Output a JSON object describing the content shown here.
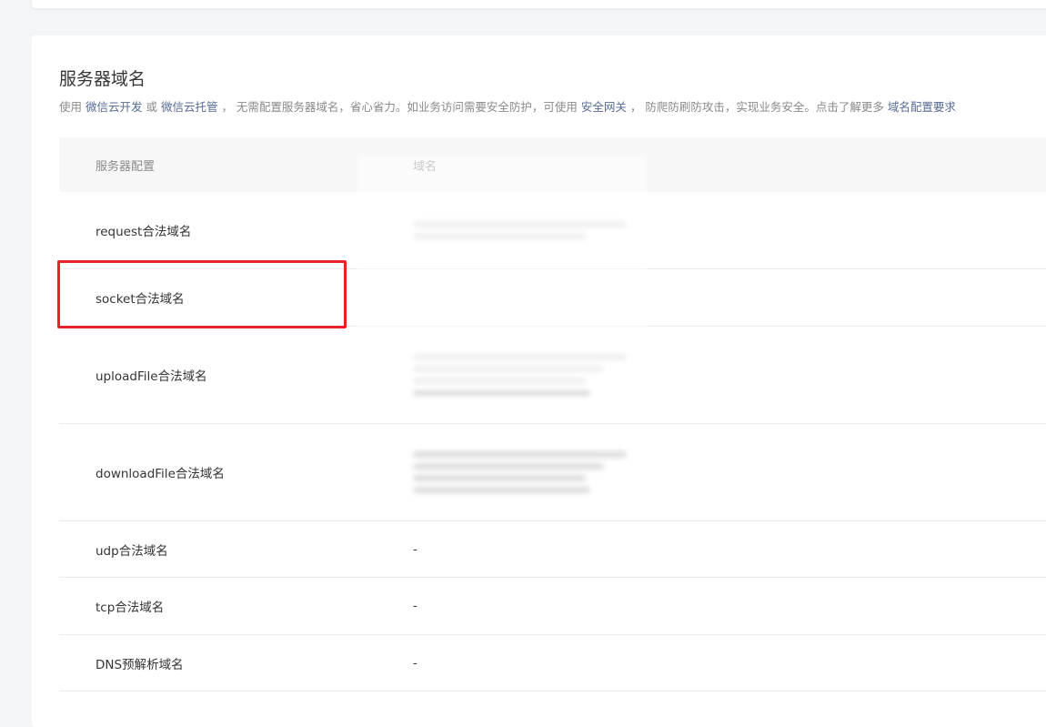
{
  "section": {
    "title": "服务器域名",
    "desc_parts": [
      {
        "text": "使用 ",
        "link": false
      },
      {
        "text": "微信云开发",
        "link": true
      },
      {
        "text": " 或 ",
        "link": false
      },
      {
        "text": "微信云托管",
        "link": true
      },
      {
        "text": " ， 无需配置服务器域名，省心省力。如业务访问需要安全防护，可使用 ",
        "link": false
      },
      {
        "text": "安全网关",
        "link": true
      },
      {
        "text": " ， 防爬防刷防攻击，实现业务安全。点击了解更多 ",
        "link": false
      },
      {
        "text": "域名配置要求",
        "link": true
      }
    ]
  },
  "table": {
    "headers": {
      "config": "服务器配置",
      "domain": "域名"
    },
    "rows": [
      {
        "label": "request合法域名",
        "value": ""
      },
      {
        "label": "socket合法域名",
        "value": ""
      },
      {
        "label": "uploadFile合法域名",
        "value": ""
      },
      {
        "label": "downloadFile合法域名",
        "value": ""
      },
      {
        "label": "udp合法域名",
        "value": "-"
      },
      {
        "label": "tcp合法域名",
        "value": "-"
      },
      {
        "label": "DNS预解析域名",
        "value": "-"
      }
    ]
  },
  "colors": {
    "link": "#576b95",
    "highlight": "#e8202a",
    "header_bg": "#f7f7f7"
  }
}
